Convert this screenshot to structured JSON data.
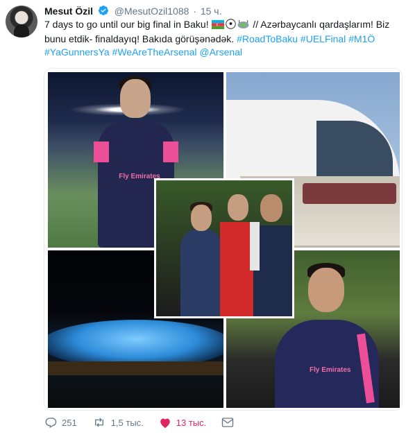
{
  "tweet": {
    "name": "Mesut Özil",
    "handle": "@MesutOzil1088",
    "separator": "·",
    "time": "15 ч.",
    "text_line1": "7 days to go until our big final in Baku!",
    "text_part2": "// Azərbaycanlı qardaşlarım! Biz bunu etdik- finaldayıq! Bakıda görüşənədək.",
    "hashtags": [
      "#RoadToBaku",
      "#UELFinal",
      "#M1Ö",
      "#YaGunnersYa",
      "#WeAreTheArsenal"
    ],
    "mention": "@Arsenal",
    "photo_texts": {
      "fly_emirates_1": "Fly Emirates",
      "fly_emirates_2": "Fly Emirates"
    }
  },
  "actions": {
    "reply_count": "251",
    "retweet_count": "1,5 тыс.",
    "like_count": "13 тыс."
  },
  "colors": {
    "link": "#1da1f2",
    "like": "#e0245e",
    "muted": "#657786"
  },
  "icons": [
    "verified-badge-icon",
    "reply-icon",
    "retweet-icon",
    "like-heart-icon",
    "direct-message-icon"
  ]
}
